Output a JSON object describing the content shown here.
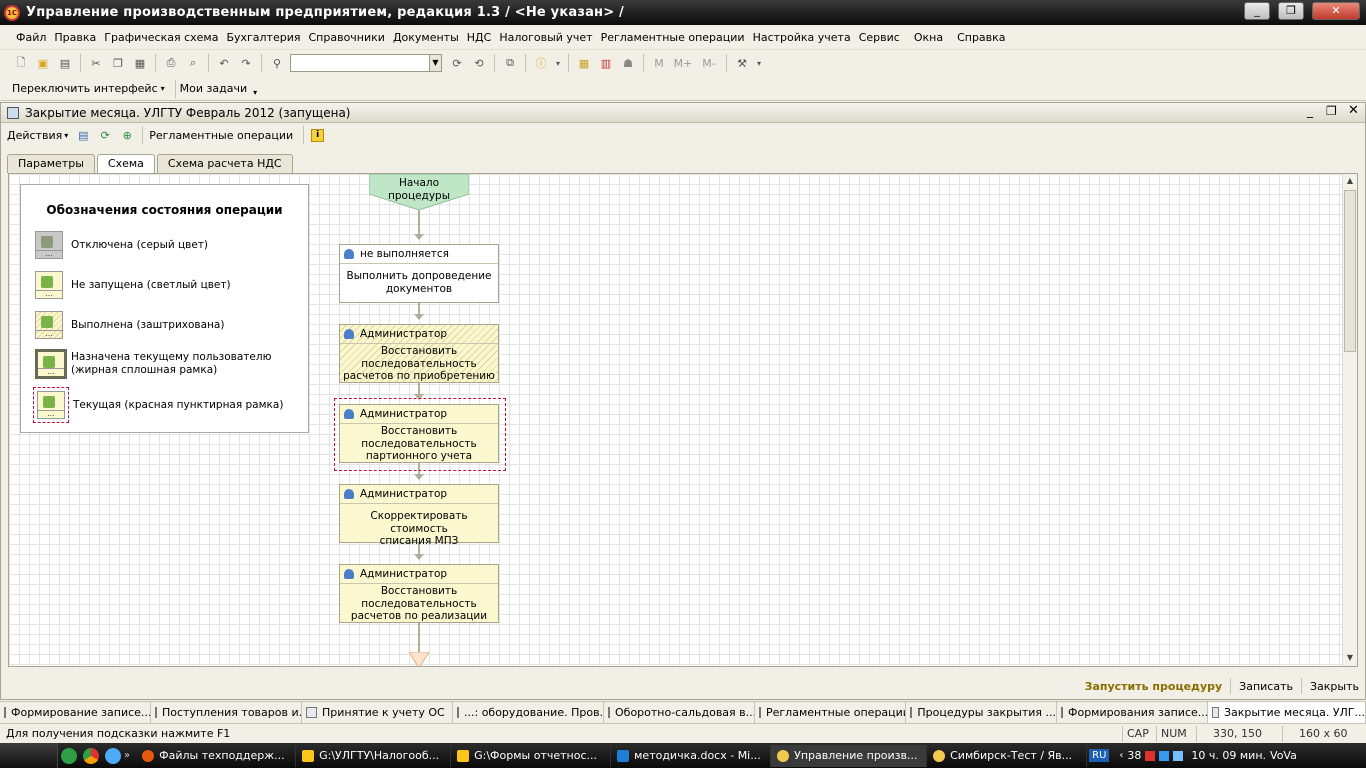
{
  "window": {
    "title": "Управление производственным предприятием, редакция 1.3 / <Не указан> /",
    "logo_text": "1С",
    "controls": [
      "_",
      "❐",
      "✕"
    ]
  },
  "menu": [
    "Файл",
    "Правка",
    "Графическая схема",
    "Бухгалтерия",
    "Справочники",
    "Документы",
    "НДС",
    "Налоговый учет",
    "Регламентные операции",
    "Настройка учета",
    "Сервис",
    "Окна",
    "Справка"
  ],
  "toolbar": {
    "m_buttons": [
      "M",
      "M+",
      "M-"
    ]
  },
  "toolbar2": {
    "switch_interface": "Переключить интерфейс",
    "my_tasks": "Мои задачи"
  },
  "doc": {
    "title": "Закрытие месяца. УЛГТУ Февраль 2012 (запущена)",
    "actions_label": "Действия",
    "reg_ops_label": "Регламентные операции",
    "tabs": [
      "Параметры",
      "Схема",
      "Схема расчета НДС"
    ],
    "active_tab": "Схема"
  },
  "legend": {
    "title": "Обозначения состояния операции",
    "items": [
      {
        "line1": "Отключена (серый цвет)",
        "line2": ""
      },
      {
        "line1": "Не запущена (светлый цвет)",
        "line2": ""
      },
      {
        "line1": "Выполнена (заштрихована)",
        "line2": ""
      },
      {
        "line1": "Назначена текущему пользователю",
        "line2": "(жирная сплошная рамка)"
      },
      {
        "line1": "Текущая (красная пунктирная рамка)",
        "line2": ""
      }
    ]
  },
  "flow": {
    "start": {
      "line1": "Начало",
      "line2": "процедуры"
    },
    "nodes": [
      {
        "owner": "не выполняется",
        "lines": [
          "Выполнить допроведение",
          "документов"
        ],
        "state": "white"
      },
      {
        "owner": "Администратор",
        "lines": [
          "Восстановить",
          "последовательность",
          "расчетов по приобретению"
        ],
        "state": "hatched"
      },
      {
        "owner": "Администратор",
        "lines": [
          "Восстановить",
          "последовательность",
          "партионного учета"
        ],
        "state": "current"
      },
      {
        "owner": "Администратор",
        "lines": [
          "Скорректировать стоимость",
          "списания МПЗ"
        ],
        "state": "yellow"
      },
      {
        "owner": "Администратор",
        "lines": [
          "Восстановить",
          "последовательность",
          "расчетов по реализации"
        ],
        "state": "yellow"
      }
    ]
  },
  "doc_bottom": {
    "run": "Запустить процедуру",
    "save": "Записать",
    "close": "Закрыть"
  },
  "window_tabs": [
    "Формирование записе...",
    "Поступления товаров и...",
    "Принятие к учету ОС",
    "...: оборудование. Пров...",
    "Оборотно-сальдовая в...",
    "Регламентные операции",
    "Процедуры закрытия ...",
    "Формирования записе...",
    "Закрытие месяца. УЛГ..."
  ],
  "status": {
    "hint": "Для получения подсказки нажмите F1",
    "cap": "CAP",
    "num": "NUM",
    "coords": "330, 150",
    "size": "160 x 60"
  },
  "taskbar": {
    "items": [
      "Файлы техподдерж...",
      "G:\\УЛГТУ\\Налогооб...",
      "G:\\Формы отчетнос...",
      "методичка.docx - Mi...",
      "Управление произв...",
      "Симбирск-Тест / Яв..."
    ],
    "lang": "RU",
    "volume": "38",
    "clock": "10 ч. 09 мин.",
    "user": "VoVa"
  }
}
